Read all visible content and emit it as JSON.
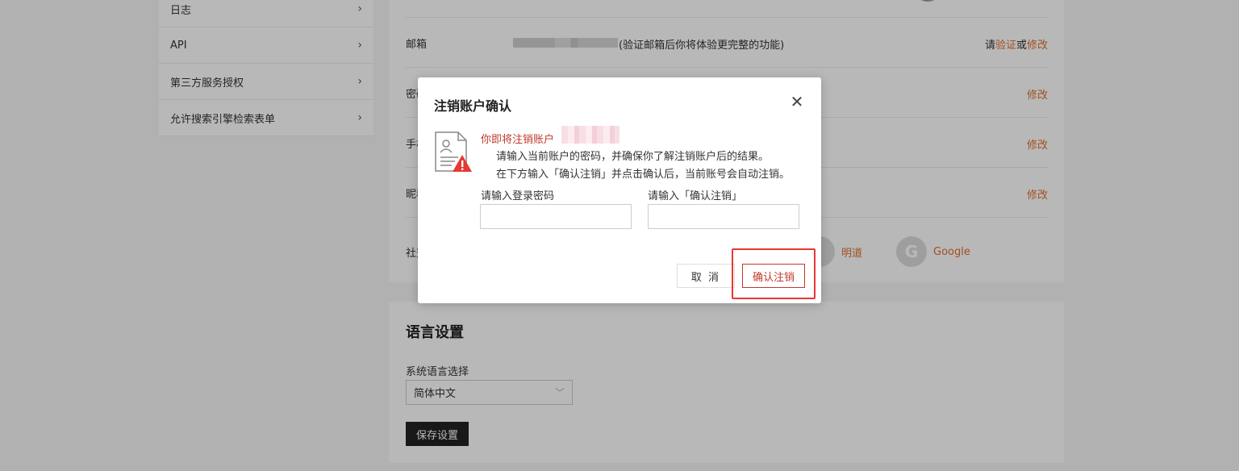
{
  "sidebar": {
    "items": [
      {
        "label": "日志"
      },
      {
        "label": "API"
      },
      {
        "label": "第三方服务授权"
      },
      {
        "label": "允许搜索引擎检索表单"
      }
    ]
  },
  "account": {
    "email_label": "邮箱",
    "email_note": "(验证邮箱后你将体验更完整的功能)",
    "email_action_prefix": "请",
    "email_verify": "验证",
    "email_or": "或",
    "email_modify": "修改",
    "password_label": "密码",
    "password_action": "修改",
    "phone_label": "手机",
    "phone_action": "修改",
    "nickname_label": "昵称",
    "nickname_action": "修改",
    "social_label": "社交",
    "social_accounts": [
      {
        "name": "明道",
        "icon": "mingdao-icon"
      },
      {
        "name": "Google",
        "icon": "google-icon",
        "glyph": "G"
      }
    ]
  },
  "language": {
    "title": "语言设置",
    "select_label": "系统语言选择",
    "selected": "简体中文",
    "save_label": "保存设置"
  },
  "modal": {
    "title": "注销账户确认",
    "close_glyph": "✕",
    "warning_heading": "你即将注销账户",
    "line1": "请输入当前账户的密码，并确保你了解注销账户后的结果。",
    "line2": "在下方输入「确认注销」并点击确认后，当前账号会自动注销。",
    "password_field_label": "请输入登录密码",
    "password_field_value": "",
    "confirm_field_label": "请输入「确认注销」",
    "confirm_field_value": "",
    "cancel_label": "取 消",
    "confirm_label": "确认注销"
  },
  "colors": {
    "accent": "#e0702b",
    "danger": "#c0392b",
    "highlight": "#e53935"
  }
}
